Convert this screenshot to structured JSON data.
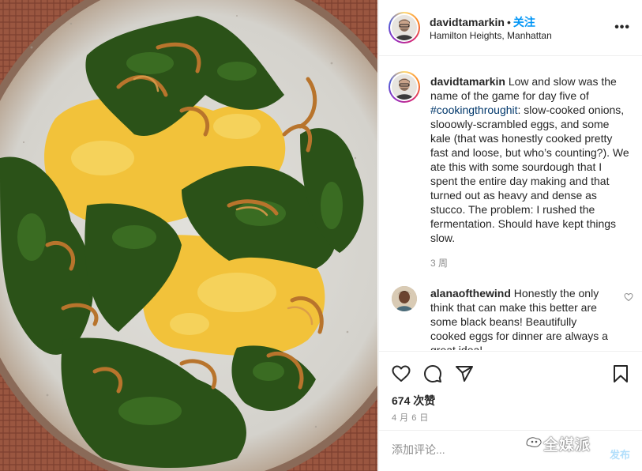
{
  "post": {
    "image_alt": "Plate of scrambled eggs, kale and slow-cooked onions",
    "colors": {
      "table_cloth": "#9c5a42",
      "plate": "#dcdad4",
      "egg": "#f4c83c",
      "kale": "#2f5a1c",
      "onion": "#b8762e"
    }
  },
  "header": {
    "username": "davidtamarkin",
    "dot": "•",
    "follow_label": "关注",
    "location": "Hamilton Heights, Manhattan",
    "more_icon": "more-horizontal-icon"
  },
  "caption": {
    "username": "davidtamarkin",
    "text_before_tag": " Low and slow was the name of the game for day five of ",
    "hashtag": "#cookingthroughit",
    "text_after_tag": ": slow-cooked onions, slooowly-scrambled eggs, and some kale (that was honestly cooked pretty fast and loose, but who’s counting?). We ate this with some sourdough that I spent the entire day making and that turned out as heavy and dense as stucco. The problem: I rushed the fermentation. Should have kept things slow.",
    "time": "3 周"
  },
  "comments": [
    {
      "username": "alanaofthewind",
      "text": " Honestly the only think that can make this better are some black beans! Beautifully cooked eggs for dinner are always a great idea!"
    }
  ],
  "actions": {
    "icons": [
      "heart-icon",
      "comment-icon",
      "share-icon",
      "bookmark-icon"
    ],
    "likes": "674 次赞",
    "date": "4 月 6 日"
  },
  "comment_box": {
    "placeholder": "添加评论...",
    "post_label": "发布"
  },
  "watermark": {
    "text": "全媒派"
  }
}
